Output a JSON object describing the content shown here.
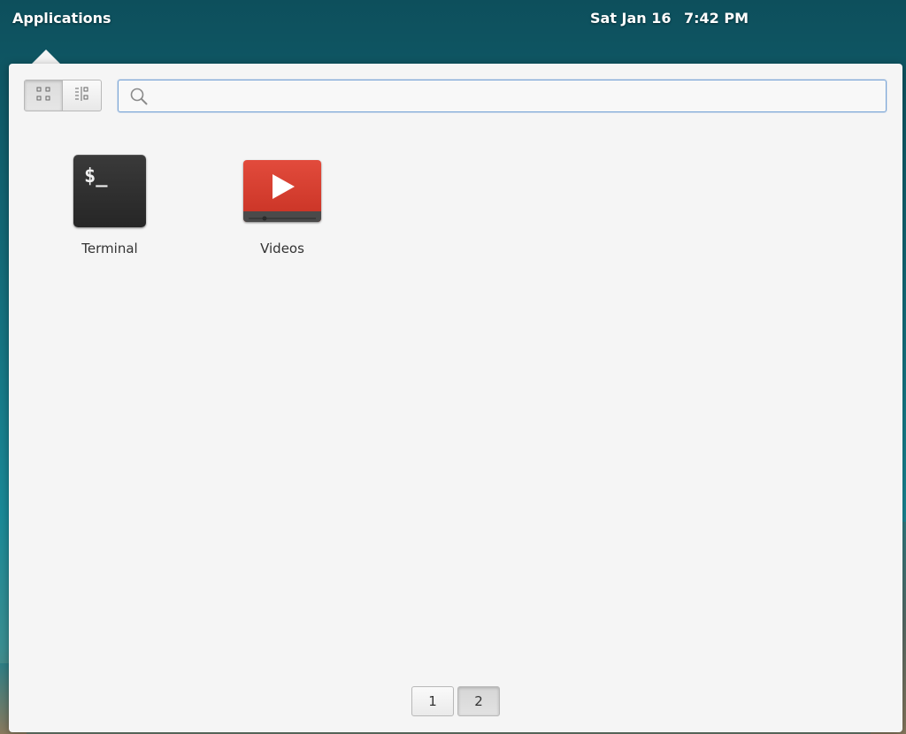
{
  "panel": {
    "applications_label": "Applications",
    "date": "Sat Jan 16",
    "time": "7:42 PM"
  },
  "launcher": {
    "view_modes": [
      {
        "name": "grid-view",
        "icon": "grid-icon",
        "active": true
      },
      {
        "name": "category-view",
        "icon": "category-list-icon",
        "active": false
      }
    ],
    "search": {
      "value": "",
      "placeholder": "",
      "icon": "search-icon"
    },
    "apps": [
      {
        "label": "Terminal",
        "icon": "terminal-icon",
        "icon_text": "$_"
      },
      {
        "label": "Videos",
        "icon": "videos-icon"
      }
    ],
    "pages": [
      {
        "label": "1",
        "active": false
      },
      {
        "label": "2",
        "active": true
      }
    ]
  },
  "colors": {
    "panel_text": "#ffffff",
    "popover_bg": "#f5f5f5",
    "search_border": "#7aa5d6",
    "terminal_bg": "#2e2e2e",
    "videos_red": "#d63c2e"
  }
}
